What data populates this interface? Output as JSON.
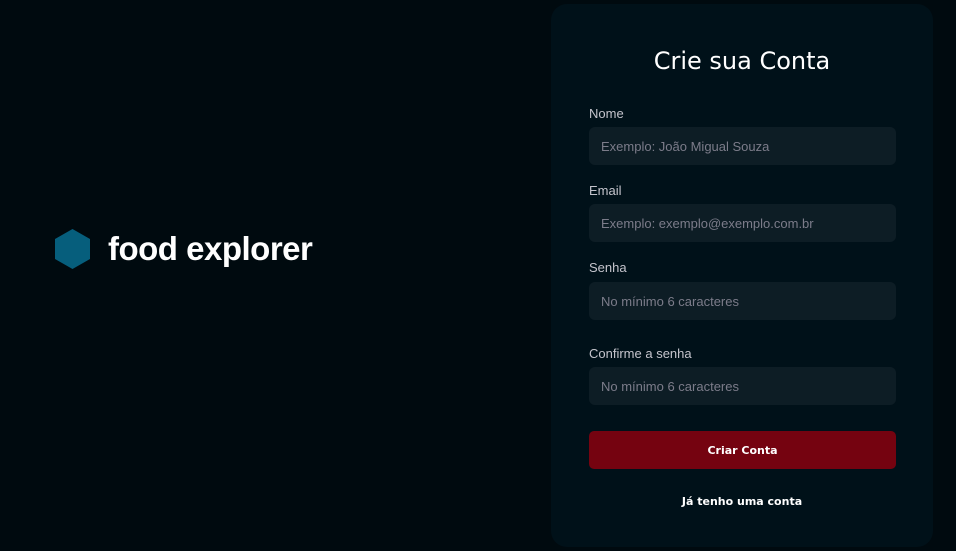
{
  "brand": {
    "name": "food explorer",
    "logo_icon": "hexagon-icon",
    "logo_color": "#065e7c"
  },
  "form": {
    "title": "Crie sua Conta",
    "fields": [
      {
        "label": "Nome",
        "placeholder": "Exemplo: João Migual Souza",
        "value": ""
      },
      {
        "label": "Email",
        "placeholder": "Exemplo: exemplo@exemplo.com.br",
        "value": ""
      },
      {
        "label": "Senha",
        "placeholder": "No mínimo 6 caracteres",
        "value": ""
      },
      {
        "label": "Confirme a senha",
        "placeholder": "No mínimo 6 caracteres",
        "value": ""
      }
    ],
    "submit_label": "Criar Conta",
    "login_link_label": "Já tenho uma conta"
  },
  "colors": {
    "background": "#000a0f",
    "card": "#001119",
    "input": "#0d1d25",
    "button": "#750310",
    "text": "#ffffff",
    "placeholder": "#7c7c8a"
  }
}
